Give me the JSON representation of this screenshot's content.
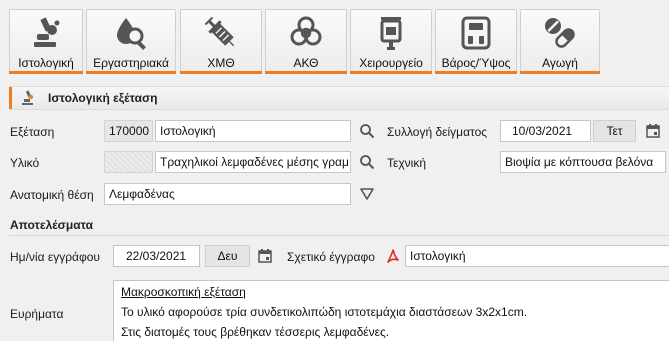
{
  "toolbar": {
    "buttons": [
      {
        "label": "Ιστολογική",
        "icon": "microscope-icon"
      },
      {
        "label": "Εργαστηριακά",
        "icon": "blood-drop-search-icon"
      },
      {
        "label": "ΧΜΘ",
        "icon": "syringe-icon"
      },
      {
        "label": "ΑΚΘ",
        "icon": "biohazard-icon"
      },
      {
        "label": "Χειρουργείο",
        "icon": "iv-bag-icon"
      },
      {
        "label": "Βάρος/Ύψος",
        "icon": "scale-icon"
      },
      {
        "label": "Αγωγή",
        "icon": "pills-icon"
      }
    ],
    "accent_color": "#f07c1c"
  },
  "section": {
    "title": "Ιστολογική εξέταση"
  },
  "form": {
    "exam_label": "Εξέταση",
    "exam_code": "170000",
    "exam_value": "Ιστολογική",
    "sample_date_label": "Συλλογή δείγματος",
    "sample_date": "10/03/2021",
    "sample_day": "Τετ",
    "material_label": "Υλικό",
    "material_value": "Τραχηλικοί λεμφαδένες μέσης γραμ",
    "technique_label": "Τεχνική",
    "technique_value": "Βιοψία με κόπτουσα βελόνα",
    "anatomic_label": "Ανατομική θέση",
    "anatomic_value": "Λεμφαδένας"
  },
  "results": {
    "title": "Αποτελέσματα",
    "doc_date_label": "Ημ/νία εγγράφου",
    "doc_date": "22/03/2021",
    "doc_day": "Δευ",
    "related_doc_label": "Σχετικό έγγραφο",
    "related_doc_value": "Ιστολογική",
    "findings_label": "Ευρήματα",
    "findings_lines": [
      "Μακροσκοπική εξέταση",
      "Το υλικό αφορούσε τρία συνδετικολιπώδη ιστοτεμάχια διαστάσεων 3x2x1cm.",
      "Στις διατομές τους βρέθηκαν τέσσερις λεμφαδένες."
    ]
  }
}
